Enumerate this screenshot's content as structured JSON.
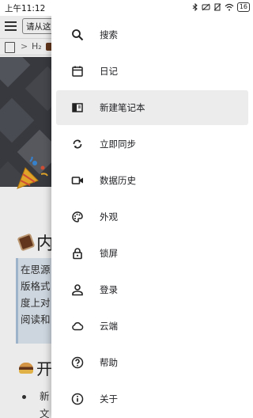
{
  "status_bar": {
    "time": "上午11:12",
    "battery": "16"
  },
  "app": {
    "notebook_select": "请从这",
    "breadcrumb": {
      "separator": ">",
      "heading": "H₂"
    },
    "heading1_visible": "内",
    "quote_lines": [
      "在思源",
      "版格式",
      "度上对",
      "阅读和"
    ],
    "heading2_visible": "开",
    "list_lines": [
      "新",
      "文"
    ]
  },
  "drawer": {
    "items": [
      {
        "label": "搜索",
        "icon": "search-icon"
      },
      {
        "label": "日记",
        "icon": "calendar-icon"
      },
      {
        "label": "新建笔记本",
        "icon": "new-notebook-icon"
      },
      {
        "label": "立即同步",
        "icon": "sync-icon"
      },
      {
        "label": "数据历史",
        "icon": "video-history-icon"
      },
      {
        "label": "外观",
        "icon": "palette-icon"
      },
      {
        "label": "锁屏",
        "icon": "lock-icon"
      },
      {
        "label": "登录",
        "icon": "person-icon"
      },
      {
        "label": "云端",
        "icon": "cloud-icon"
      },
      {
        "label": "帮助",
        "icon": "help-icon"
      },
      {
        "label": "关于",
        "icon": "info-icon"
      }
    ],
    "active_index": 2
  },
  "colors": {
    "active_item_bg": "#ececec",
    "quote_bg": "#dfe8f2",
    "cover_bg": "#3c3e45"
  }
}
